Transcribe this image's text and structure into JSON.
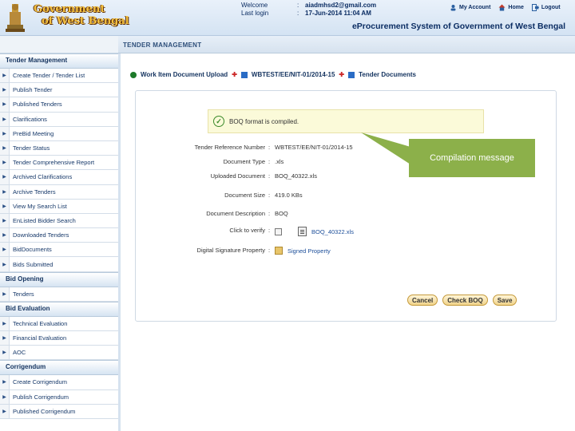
{
  "header": {
    "logo_line1": "Government",
    "logo_line2": "of West Bengal",
    "welcome_label": "Welcome",
    "welcome_value": "aiadmhsd2@gmail.com",
    "last_login_label": "Last login",
    "last_login_value": "17-Jun-2014 11:04 AM",
    "colon": ":",
    "links": {
      "my_account": "My Account",
      "home": "Home",
      "logout": "Logout"
    },
    "system_title": "eProcurement System of Government of West Bengal"
  },
  "page_section": "TENDER MANAGEMENT",
  "sidebar": {
    "sections": [
      {
        "title": "Tender Management",
        "items": [
          "Create Tender / Tender List",
          "Publish Tender",
          "Published Tenders",
          "Clarifications",
          "PreBid Meeting",
          "Tender Status",
          "Tender Comprehensive Report",
          "Archived Clarifications",
          "Archive Tenders",
          "View My Search List",
          "EnListed Bidder Search",
          "Downloaded Tenders",
          "BidDocuments",
          "Bids Submitted"
        ]
      },
      {
        "title": "Bid Opening",
        "items": [
          "Tenders"
        ]
      },
      {
        "title": "Bid Evaluation",
        "items": [
          "Technical Evaluation",
          "Financial Evaluation",
          "AOC"
        ]
      },
      {
        "title": "Corrigendum",
        "items": [
          "Create Corrigendum",
          "Publish Corrigendum",
          "Published Corrigendum"
        ]
      }
    ]
  },
  "breadcrumb": {
    "item1": "Work Item Document Upload",
    "item2": "WBTEST/EE/NIT-01/2014-15",
    "item3": "Tender Documents"
  },
  "notice": "BOQ format is compiled.",
  "form": {
    "fields": [
      {
        "label": "Tender Reference Number",
        "value": "WBTEST/EE/NIT-01/2014-15"
      },
      {
        "label": "Document Type",
        "value": ".xls"
      },
      {
        "label": "Uploaded Document",
        "value": "BOQ_40322.xls"
      },
      {
        "label": "Document Size",
        "value": "419.0 KBs"
      },
      {
        "label": "Document Description",
        "value": "BOQ"
      },
      {
        "label": "Click to verify",
        "value": "BOQ_40322.xls"
      },
      {
        "label": "Digital Signature Property",
        "value": "Signed Property"
      }
    ]
  },
  "buttons": {
    "cancel": "Cancel",
    "check_boq": "Check BOQ",
    "save": "Save"
  },
  "callout": "Compilation message",
  "colors": {
    "header_text": "#0b2d63",
    "logo_gold": "#f5c242",
    "callout_green": "#8cb04a",
    "button_gold": "#f0d38a"
  }
}
